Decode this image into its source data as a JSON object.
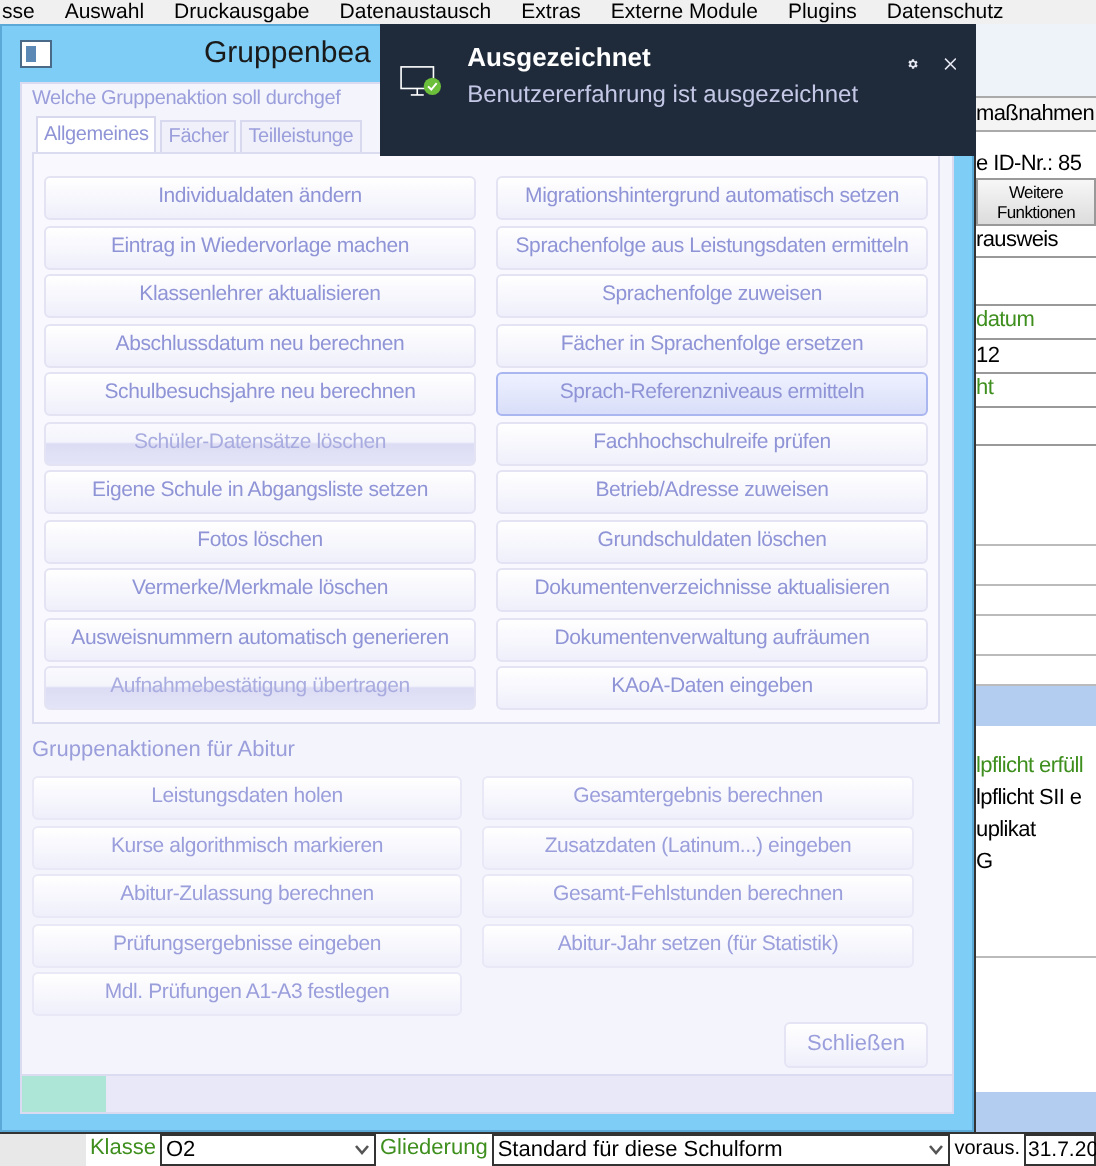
{
  "menu_bar": [
    "sse",
    "Auswahl",
    "Druckausgabe",
    "Datenaustausch",
    "Extras",
    "Externe Module",
    "Plugins",
    "Datenschutz"
  ],
  "background_panel": {
    "header": "maßnahmen",
    "id_label": "e ID-Nr.: 85",
    "more_button": "Weitere Funktionen",
    "field_1": "rausweis",
    "label_1": "datum",
    "field_2": "12",
    "label_2": "ht",
    "notes": [
      {
        "text": "lpflicht erfüll",
        "kind": "label"
      },
      {
        "text": "lpflicht SII e",
        "kind": "value"
      },
      {
        "text": "uplikat",
        "kind": "value"
      },
      {
        "text": "G",
        "kind": "value"
      }
    ]
  },
  "bottom_bar": {
    "class_label": "Klasse",
    "class_value": "O2",
    "structure_label": "Gliederung",
    "structure_value": "Standard für diese Schulform",
    "date_label": "voraus.",
    "date_value": "31.7.20"
  },
  "dialog": {
    "title": "Gruppenbea",
    "group_label": "Welche Gruppenaktion soll durchgef",
    "tabs": [
      {
        "label": "Allgemeines",
        "selected": true
      },
      {
        "label": "Fächer",
        "selected": false
      },
      {
        "label": "Teilleistunge",
        "selected": false
      }
    ],
    "actions": [
      {
        "label": "Individualdaten ändern",
        "disabled": false,
        "focused": false
      },
      {
        "label": "Migrationshintergrund automatisch setzen",
        "disabled": false,
        "focused": false
      },
      {
        "label": "Eintrag in Wiedervorlage machen",
        "disabled": false,
        "focused": false
      },
      {
        "label": "Sprachenfolge aus Leistungsdaten ermitteln",
        "disabled": false,
        "focused": false
      },
      {
        "label": "Klassenlehrer aktualisieren",
        "disabled": false,
        "focused": false
      },
      {
        "label": "Sprachenfolge zuweisen",
        "disabled": false,
        "focused": false
      },
      {
        "label": "Abschlussdatum neu berechnen",
        "disabled": false,
        "focused": false
      },
      {
        "label": "Fächer in Sprachenfolge ersetzen",
        "disabled": false,
        "focused": false
      },
      {
        "label": "Schulbesuchsjahre neu berechnen",
        "disabled": false,
        "focused": false
      },
      {
        "label": "Sprach-Referenzniveaus ermitteln",
        "disabled": false,
        "focused": true
      },
      {
        "label": "Schüler-Datensätze löschen",
        "disabled": true,
        "focused": false
      },
      {
        "label": "Fachhochschulreife prüfen",
        "disabled": false,
        "focused": false
      },
      {
        "label": "Eigene Schule in Abgangsliste setzen",
        "disabled": false,
        "focused": false
      },
      {
        "label": "Betrieb/Adresse zuweisen",
        "disabled": false,
        "focused": false
      },
      {
        "label": "Fotos löschen",
        "disabled": false,
        "focused": false
      },
      {
        "label": "Grundschuldaten löschen",
        "disabled": false,
        "focused": false
      },
      {
        "label": "Vermerke/Merkmale löschen",
        "disabled": false,
        "focused": false
      },
      {
        "label": "Dokumentenverzeichnisse aktualisieren",
        "disabled": false,
        "focused": false
      },
      {
        "label": "Ausweisnummern automatisch generieren",
        "disabled": false,
        "focused": false
      },
      {
        "label": "Dokumentenverwaltung aufräumen",
        "disabled": false,
        "focused": false
      },
      {
        "label": "Aufnahmebestätigung übertragen",
        "disabled": true,
        "focused": false
      },
      {
        "label": "KAoA-Daten eingeben",
        "disabled": false,
        "focused": false
      }
    ],
    "abitur_label": "Gruppenaktionen für Abitur",
    "abitur_left": [
      "Leistungsdaten holen",
      "Kurse algorithmisch markieren",
      "Abitur-Zulassung berechnen",
      "Prüfungsergebnisse eingeben",
      "Mdl. Prüfungen A1-A3 festlegen"
    ],
    "abitur_right": [
      "Gesamtergebnis berechnen",
      "Zusatzdaten (Latinum...) eingeben",
      "Gesamt-Fehlstunden berechnen",
      "Abitur-Jahr setzen (für Statistik)"
    ],
    "close_button": "Schließen",
    "progress": {
      "level": 0.09
    }
  },
  "notification": {
    "title": "Ausgezeichnet",
    "message": "Benutzererfahrung ist ausgezeichnet"
  }
}
